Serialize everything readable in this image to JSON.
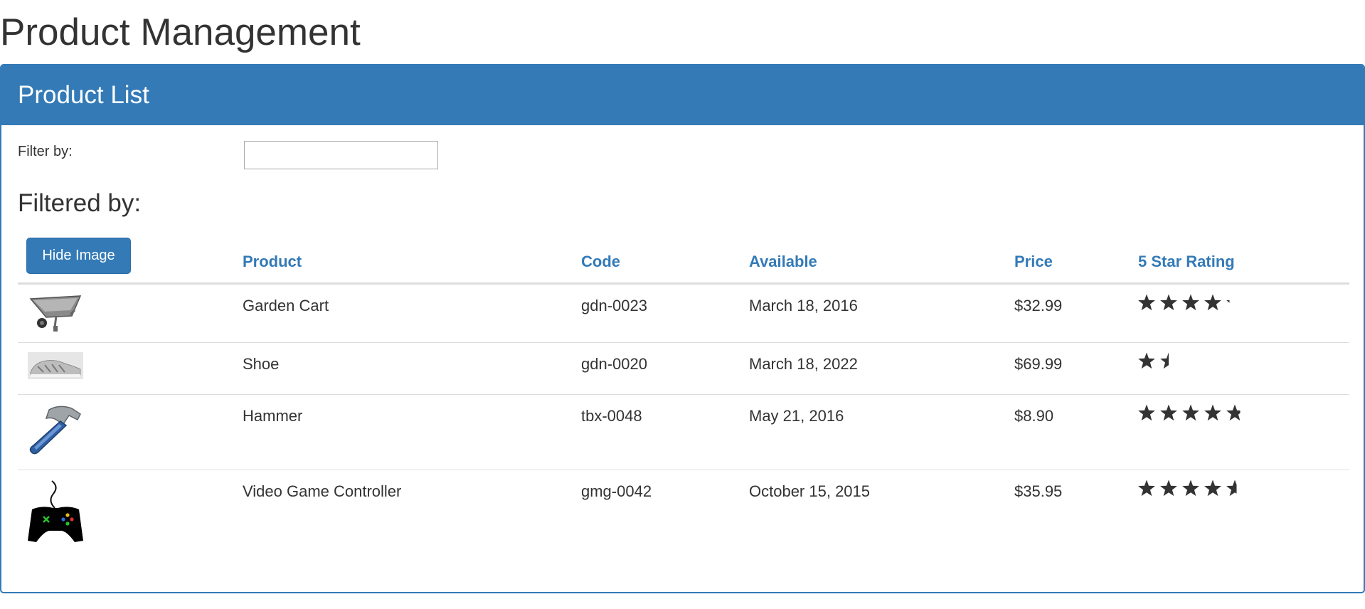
{
  "page": {
    "title": "Product Management"
  },
  "panel": {
    "title": "Product List"
  },
  "filter": {
    "label": "Filter by:",
    "value": "",
    "placeholder": ""
  },
  "filtered": {
    "heading": "Filtered by:"
  },
  "toolbar": {
    "hide_image_label": "Hide Image"
  },
  "table": {
    "columns": [
      "Product",
      "Code",
      "Available",
      "Price",
      "5 Star Rating"
    ],
    "rows": [
      {
        "image": "wheelbarrow-image",
        "product": "Garden Cart",
        "code": "gdn-0023",
        "available": "March 18, 2016",
        "price": "$32.99",
        "rating": 4.2
      },
      {
        "image": "shoe-image",
        "product": "Shoe",
        "code": "gdn-0020",
        "available": "March 18, 2022",
        "price": "$69.99",
        "rating": 1.5
      },
      {
        "image": "hammer-image",
        "product": "Hammer",
        "code": "tbx-0048",
        "available": "May 21, 2016",
        "price": "$8.90",
        "rating": 4.8
      },
      {
        "image": "game-controller-image",
        "product": "Video Game Controller",
        "code": "gmg-0042",
        "available": "October 15, 2015",
        "price": "$35.95",
        "rating": 4.6
      }
    ]
  },
  "colors": {
    "primary": "#337ab7",
    "text": "#333333",
    "border": "#dddddd",
    "star": "#333333"
  }
}
